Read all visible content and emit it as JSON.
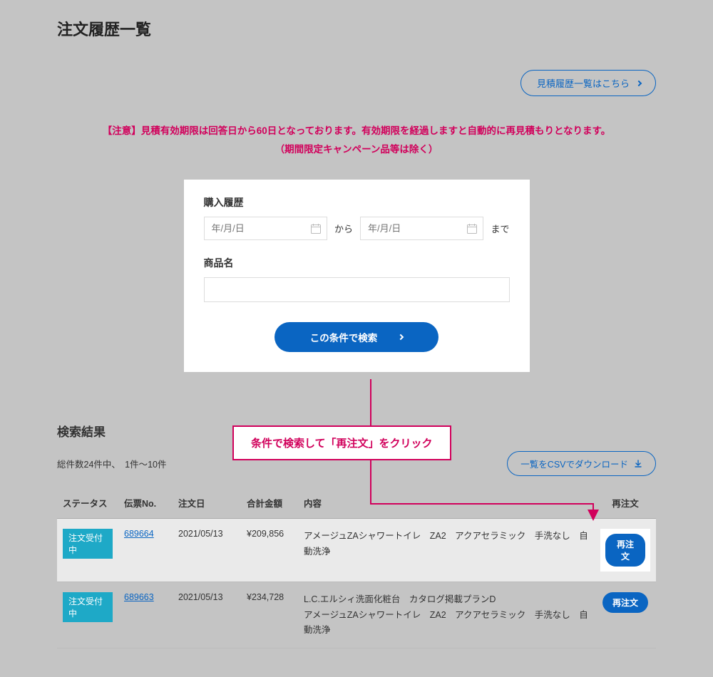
{
  "page_title": "注文履歴一覧",
  "quote_link": "見積履歴一覧はこちら",
  "notice": {
    "line1": "【注意】見積有効期限は回答日から60日となっております。有効期限を経過しますと自動的に再見積もりとなります。",
    "line2": "（期間限定キャンペーン品等は除く）"
  },
  "search": {
    "purchase_history_label": "購入履歴",
    "date_placeholder": "年/月/日",
    "kara": "から",
    "made": "まで",
    "product_name_label": "商品名",
    "search_button": "この条件で検索"
  },
  "annotation": "条件で検索して「再注文」をクリック",
  "results": {
    "title": "検索結果",
    "count_text": "総件数24件中、　1件〜10件",
    "csv_button": "一覧をCSVでダウンロード",
    "columns": {
      "status": "ステータス",
      "slip": "伝票No.",
      "date": "注文日",
      "amount": "合計金額",
      "content": "内容",
      "reorder": "再注文"
    },
    "rows": [
      {
        "status": "注文受付中",
        "slip": "689664",
        "date": "2021/05/13",
        "amount": "¥209,856",
        "content": "アメージュZAシャワートイレ　ZA2　アクアセラミック　手洗なし　自動洗浄",
        "reorder": "再注文",
        "highlight": true
      },
      {
        "status": "注文受付中",
        "slip": "689663",
        "date": "2021/05/13",
        "amount": "¥234,728",
        "content": "L.C.エルシィ洗面化粧台　カタログ掲載プランD\nアメージュZAシャワートイレ　ZA2　アクアセラミック　手洗なし　自動洗浄",
        "reorder": "再注文",
        "highlight": false
      }
    ]
  }
}
